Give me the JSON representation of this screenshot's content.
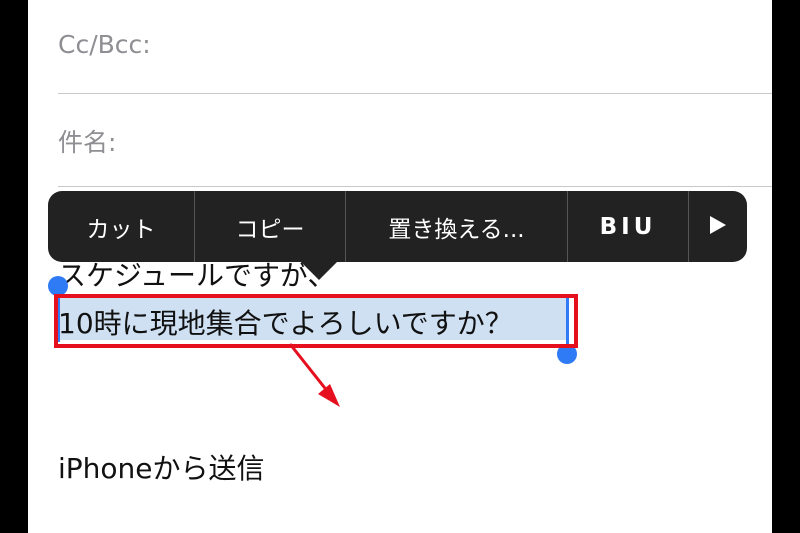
{
  "compose": {
    "cc_bcc_label": "Cc/Bcc:",
    "subject_label": "件名:"
  },
  "edit_menu": {
    "cut": "カット",
    "copy": "コピー",
    "replace": "置き換える...",
    "format": "BIU",
    "more_icon": "play-triangle-icon"
  },
  "body": {
    "line_1": "スケジュールですが、",
    "line_2_selected": "10時に現地集合でよろしいですか？",
    "signature": "iPhoneから送信"
  },
  "colors": {
    "annotation": "#e60f1e",
    "selection": "#cfe0f2",
    "handle": "#2f7bf5",
    "menu_bg": "#222222"
  }
}
